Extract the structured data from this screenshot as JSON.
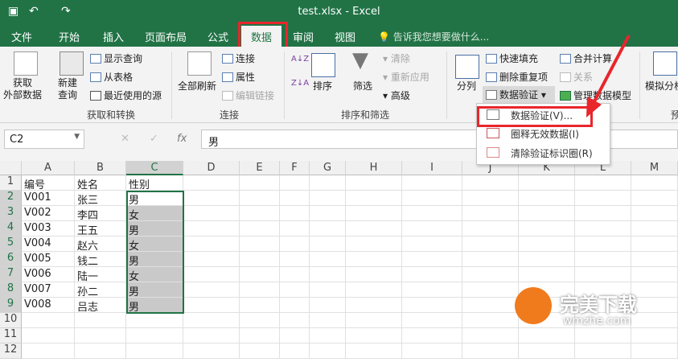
{
  "title_bar": {
    "file_title": "test.xlsx - Excel",
    "save_icon": "save-icon",
    "undo": "↶",
    "redo": "↷"
  },
  "tabs": [
    "文件",
    "开始",
    "插入",
    "页面布局",
    "公式",
    "数据",
    "审阅",
    "视图"
  ],
  "active_tab": "数据",
  "tell_me": "告诉我您想要做什么...",
  "ribbon": {
    "get_external": "获取\n外部数据",
    "new_query": "新建\n查询",
    "show_queries": "显示查询",
    "from_table": "从表格",
    "recent_sources": "最近使用的源",
    "group_get_transform": "获取和转换",
    "refresh_all": "全部刷新",
    "connections": "连接",
    "properties": "属性",
    "edit_links": "编辑链接",
    "group_connections": "连接",
    "sort": "排序",
    "filter": "筛选",
    "clear": "清除",
    "reapply": "重新应用",
    "advanced": "高级",
    "group_sort_filter": "排序和筛选",
    "text_to_columns": "分列",
    "flash_fill": "快速填充",
    "remove_duplicates": "删除重复项",
    "data_validation": "数据验证",
    "consolidate": "合并计算",
    "relationships": "关系",
    "manage_data_model": "管理数据模型",
    "what_if": "模拟分析",
    "forecast_partial": "预"
  },
  "formula_bar": {
    "name_box": "C2",
    "fx": "fx",
    "value": "男"
  },
  "columns": [
    "A",
    "B",
    "C",
    "D",
    "E",
    "F",
    "G",
    "H",
    "I",
    "J",
    "K",
    "L",
    "M"
  ],
  "rows": [
    [
      "编号",
      "姓名",
      "性别"
    ],
    [
      "V001",
      "张三",
      "男"
    ],
    [
      "V002",
      "李四",
      "女"
    ],
    [
      "V003",
      "王五",
      "男"
    ],
    [
      "V004",
      "赵六",
      "女"
    ],
    [
      "V005",
      "钱二",
      "男"
    ],
    [
      "V006",
      "陆一",
      "女"
    ],
    [
      "V007",
      "孙二",
      "男"
    ],
    [
      "V008",
      "吕志",
      "男"
    ],
    [
      "",
      "",
      ""
    ],
    [
      "",
      "",
      ""
    ],
    [
      "",
      "",
      ""
    ]
  ],
  "validation_menu": [
    "数据验证(V)...",
    "圈释无效数据(I)",
    "清除验证标识圈(R)"
  ],
  "watermark": {
    "brand": "完美下载",
    "url": "wmzhe.com"
  },
  "colors": {
    "excel_green": "#217346",
    "highlight_red": "#e8262c"
  }
}
